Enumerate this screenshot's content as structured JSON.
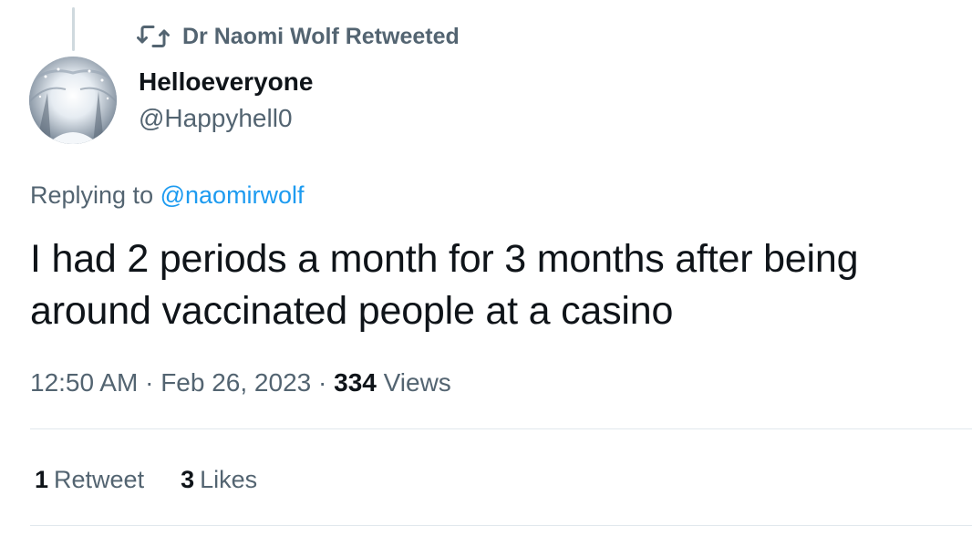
{
  "retweet_banner": {
    "icon": "retweet-icon",
    "text": "Dr Naomi Wolf Retweeted"
  },
  "author": {
    "display_name": "Helloeveryone",
    "handle": "@Happyhell0",
    "avatar": "snowy-forest-avatar"
  },
  "reply_context": {
    "prefix": "Replying to",
    "mention": "@naomirwolf"
  },
  "tweet": {
    "text": "I had 2 periods a month for 3 months after being around vaccinated people at a casino"
  },
  "meta": {
    "time": "12:50 AM",
    "separator": "·",
    "date": "Feb 26, 2023",
    "views_count": "334",
    "views_label": "Views"
  },
  "stats": {
    "retweets_count": "1",
    "retweets_label": "Retweet",
    "likes_count": "3",
    "likes_label": "Likes"
  },
  "colors": {
    "link": "#1d9bf0",
    "secondary_text": "#536471",
    "primary_text": "#0f1419"
  }
}
